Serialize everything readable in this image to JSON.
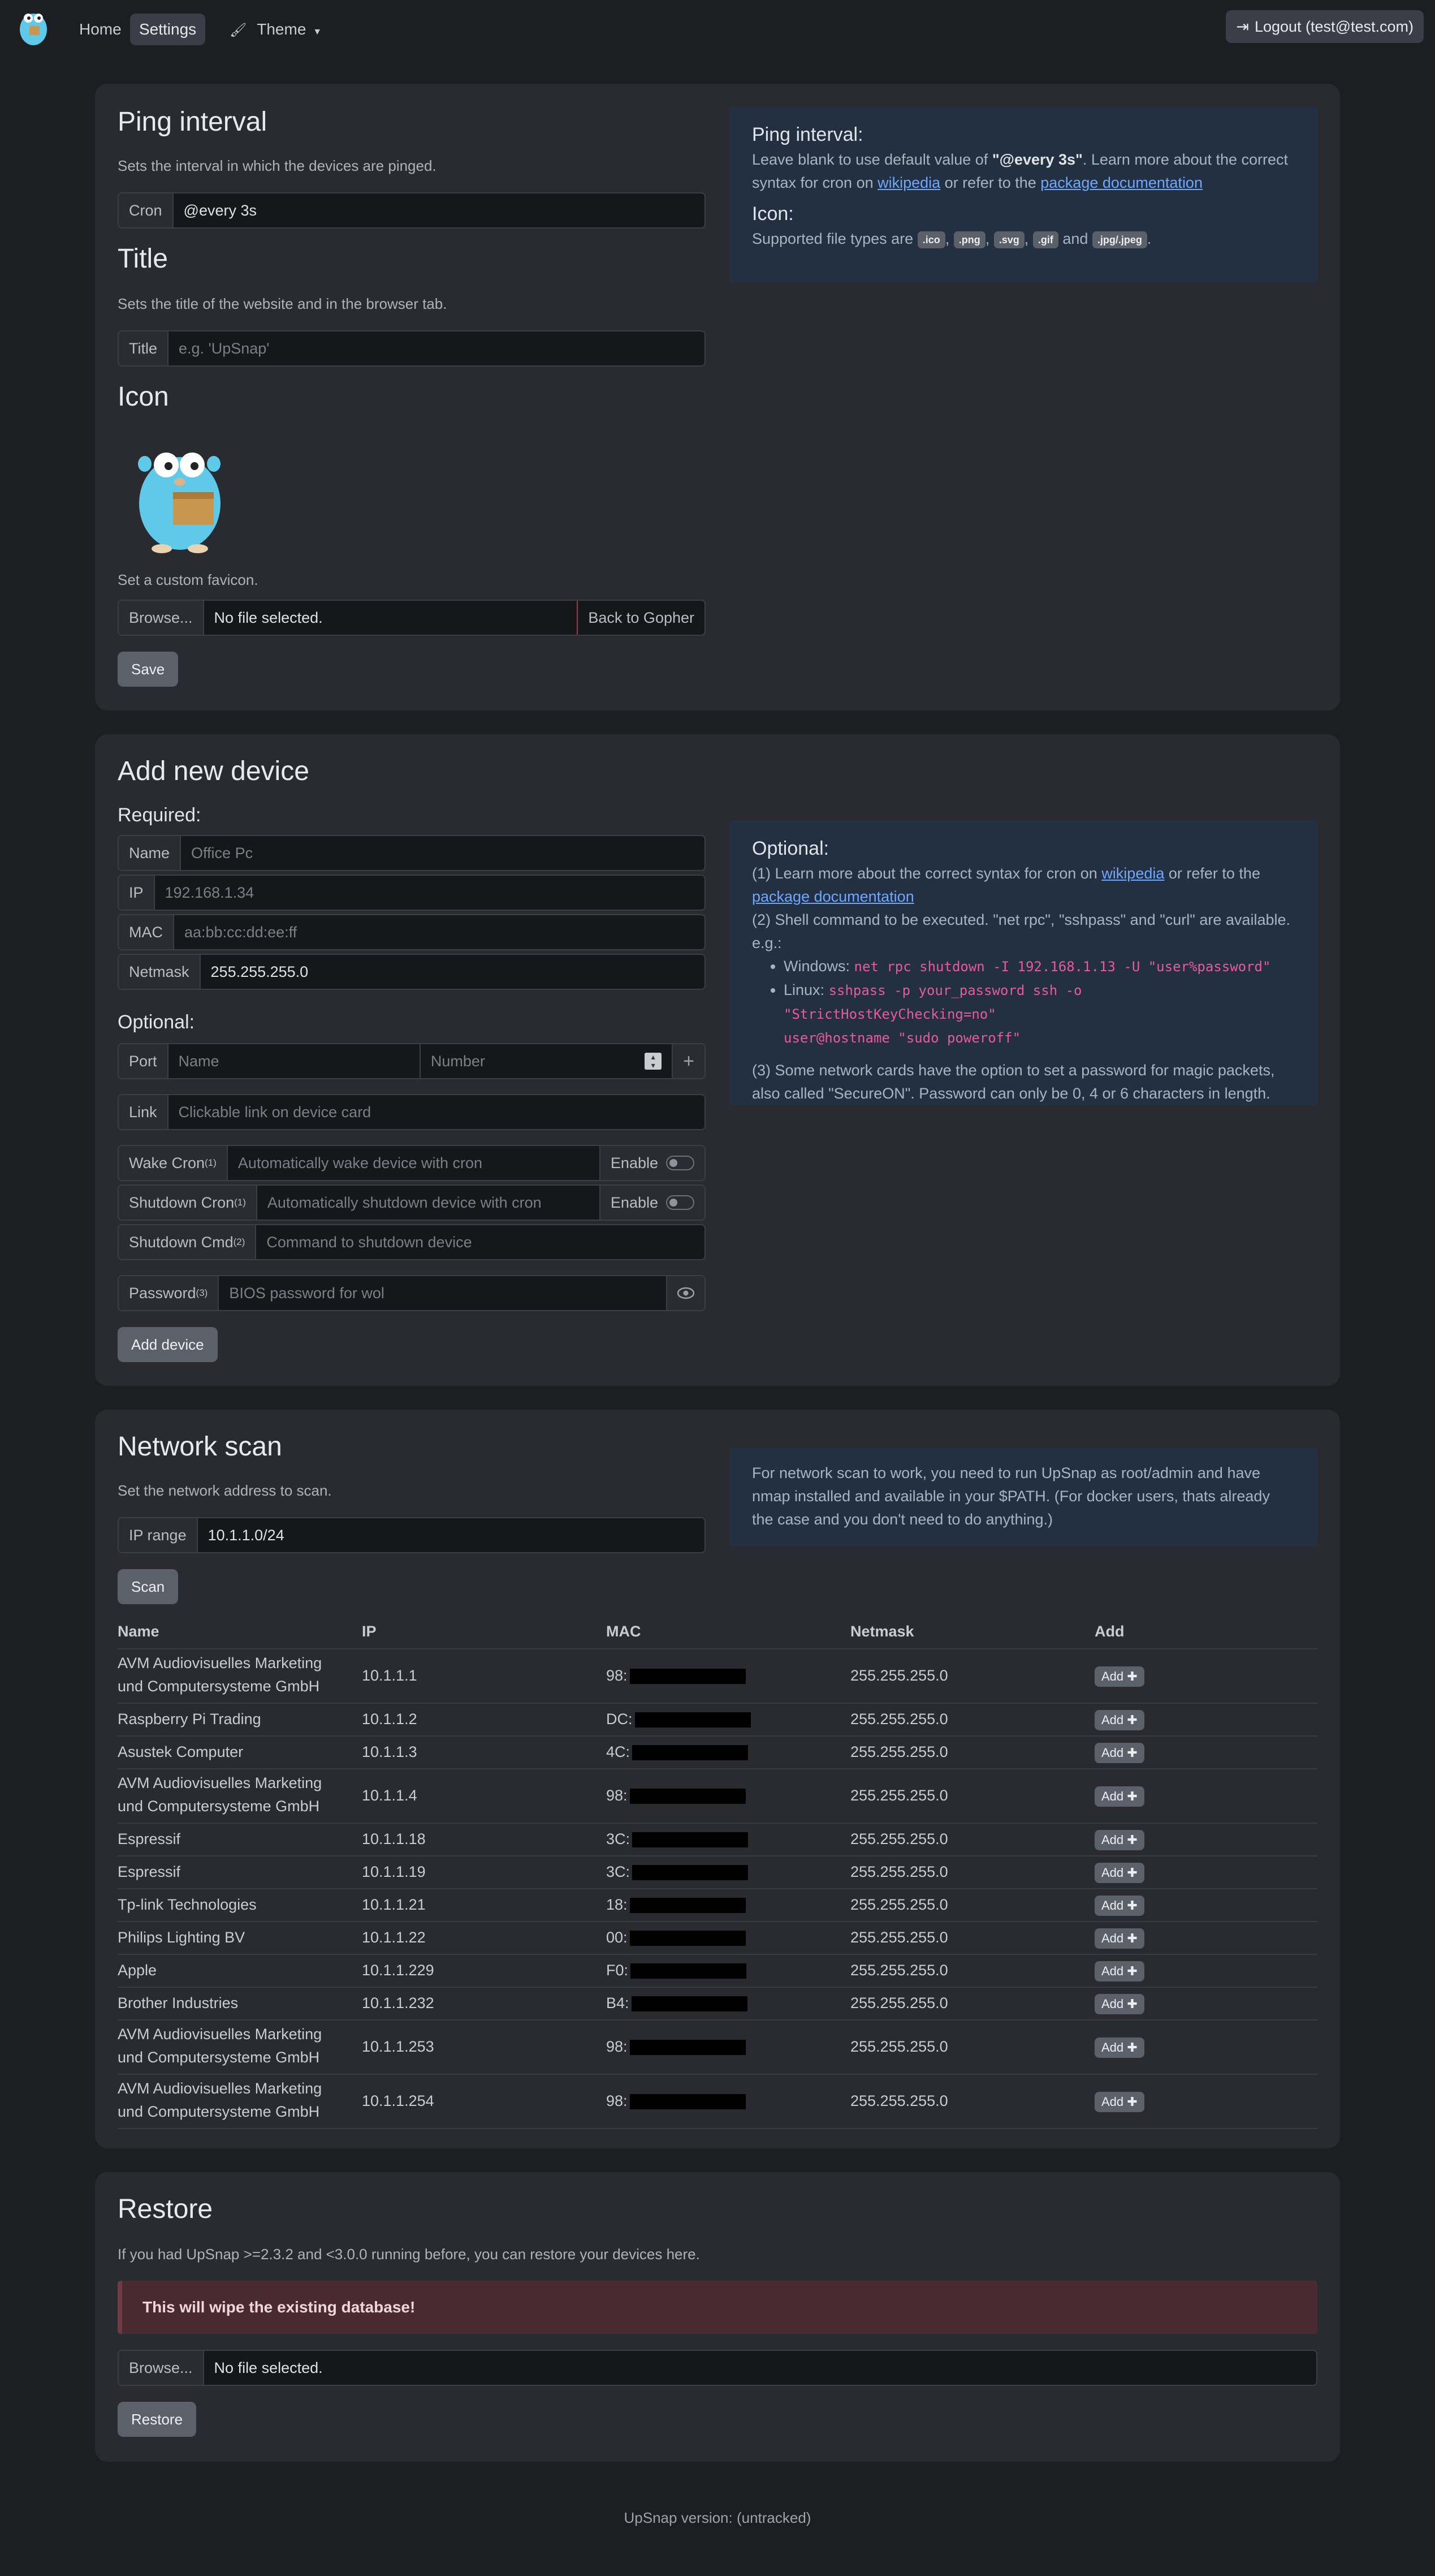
{
  "navbar": {
    "home": "Home",
    "settings": "Settings",
    "theme": "Theme",
    "logout": "Logout (test@test.com)"
  },
  "settings_card": {
    "ping_title": "Ping interval",
    "ping_desc": "Sets the interval in which the devices are pinged.",
    "cron_label": "Cron",
    "cron_value": "@every 3s",
    "title_title": "Title",
    "title_desc": "Sets the title of the website and in the browser tab.",
    "title_label": "Title",
    "title_placeholder": "e.g. 'UpSnap'",
    "icon_title": "Icon",
    "favicon_desc": "Set a custom favicon.",
    "browse": "Browse...",
    "no_file": "No file selected.",
    "back_to_gopher": "Back to Gopher",
    "save": "Save",
    "info": {
      "ping_heading": "Ping interval:",
      "ping_text_1": "Leave blank to use default value of ",
      "ping_default": "\"@every 3s\"",
      "ping_text_2": ". Learn more about the correct syntax for cron on ",
      "wikipedia": "wikipedia",
      "or_refer": " or refer to the ",
      "package_doc": "package documentation",
      "icon_heading": "Icon:",
      "icon_text": "Supported file types are ",
      "types": [
        ".ico",
        ".png",
        ".svg",
        ".gif",
        ".jpg/.jpeg"
      ],
      "and": "and",
      "comma": ","
    }
  },
  "device_card": {
    "title": "Add new device",
    "required": "Required:",
    "name_label": "Name",
    "name_placeholder": "Office Pc",
    "ip_label": "IP",
    "ip_placeholder": "192.168.1.34",
    "mac_label": "MAC",
    "mac_placeholder": "aa:bb:cc:dd:ee:ff",
    "netmask_label": "Netmask",
    "netmask_value": "255.255.255.0",
    "optional": "Optional:",
    "port_label": "Port",
    "port_name_placeholder": "Name",
    "port_number_placeholder": "Number",
    "plus": "+",
    "link_label": "Link",
    "link_placeholder": "Clickable link on device card",
    "wake_label": "Wake Cron",
    "wake_sup": "(1)",
    "wake_placeholder": "Automatically wake device with cron",
    "enable": "Enable",
    "shutdown_cron_label": "Shutdown Cron",
    "shutdown_cron_sup": "(1)",
    "shutdown_cron_placeholder": "Automatically shutdown device with cron",
    "shutdown_cmd_label": "Shutdown Cmd",
    "shutdown_cmd_sup": "(2)",
    "shutdown_cmd_placeholder": "Command to shutdown device",
    "password_label": "Password",
    "password_sup": "(3)",
    "password_placeholder": "BIOS password for wol",
    "add_device": "Add device",
    "info": {
      "heading": "Optional:",
      "p1_a": "(1) Learn more about the correct syntax for cron on ",
      "wikipedia": "wikipedia",
      "p1_b": " or refer to the",
      "package_doc": "package documentation",
      "p2": "(2) Shell command to be executed. \"net rpc\", \"sshpass\" and \"curl\" are available.",
      "eg": "e.g.:",
      "windows_label": "Windows: ",
      "windows_cmd": "net rpc shutdown -I 192.168.1.13 -U \"user%password\"",
      "linux_label": "Linux: ",
      "linux_cmd_1": "sshpass -p your_password ssh -o \"StrictHostKeyChecking=no\"",
      "linux_cmd_2": "user@hostname \"sudo poweroff\"",
      "p3": "(3) Some network cards have the option to set a password for magic packets, also called \"SecureON\". Password can only be 0, 4 or 6 characters in length."
    }
  },
  "scan_card": {
    "title": "Network scan",
    "desc": "Set the network address to scan.",
    "ip_range_label": "IP range",
    "ip_range_value": "10.1.1.0/24",
    "scan": "Scan",
    "info": "For network scan to work, you need to run UpSnap as root/admin and have nmap installed and available in your $PATH. (For docker users, thats already the case and you don't need to do anything.)",
    "headers": [
      "Name",
      "IP",
      "MAC",
      "Netmask",
      "Add"
    ],
    "add_label": "Add",
    "rows": [
      {
        "name": "AVM Audiovisuelles Marketing und Computersysteme GmbH",
        "ip": "10.1.1.1",
        "mac": "98:",
        "netmask": "255.255.255.0"
      },
      {
        "name": "Raspberry Pi Trading",
        "ip": "10.1.1.2",
        "mac": "DC:",
        "netmask": "255.255.255.0"
      },
      {
        "name": "Asustek Computer",
        "ip": "10.1.1.3",
        "mac": "4C:",
        "netmask": "255.255.255.0"
      },
      {
        "name": "AVM Audiovisuelles Marketing und Computersysteme GmbH",
        "ip": "10.1.1.4",
        "mac": "98:",
        "netmask": "255.255.255.0"
      },
      {
        "name": "Espressif",
        "ip": "10.1.1.18",
        "mac": "3C:",
        "netmask": "255.255.255.0"
      },
      {
        "name": "Espressif",
        "ip": "10.1.1.19",
        "mac": "3C:",
        "netmask": "255.255.255.0"
      },
      {
        "name": "Tp-link Technologies",
        "ip": "10.1.1.21",
        "mac": "18:",
        "netmask": "255.255.255.0"
      },
      {
        "name": "Philips Lighting BV",
        "ip": "10.1.1.22",
        "mac": "00:",
        "netmask": "255.255.255.0"
      },
      {
        "name": "Apple",
        "ip": "10.1.1.229",
        "mac": "F0:",
        "netmask": "255.255.255.0"
      },
      {
        "name": "Brother Industries",
        "ip": "10.1.1.232",
        "mac": "B4:",
        "netmask": "255.255.255.0"
      },
      {
        "name": "AVM Audiovisuelles Marketing und Computersysteme GmbH",
        "ip": "10.1.1.253",
        "mac": "98:",
        "netmask": "255.255.255.0"
      },
      {
        "name": "AVM Audiovisuelles Marketing und Computersysteme GmbH",
        "ip": "10.1.1.254",
        "mac": "98:",
        "netmask": "255.255.255.0"
      }
    ]
  },
  "restore_card": {
    "title": "Restore",
    "desc": "If you had UpSnap >=2.3.2 and <3.0.0 running before, you can restore your devices here.",
    "alert": "This will wipe the existing database!",
    "browse": "Browse...",
    "no_file": "No file selected.",
    "restore": "Restore"
  },
  "footer": {
    "version": "UpSnap version: (untracked)"
  },
  "colors": {
    "page_bg": "#1d1e22",
    "card_bg": "#2a2b31",
    "info_bg": "#223042",
    "link": "#6ea8fe",
    "danger": "#ea5a67",
    "alert_bg": "#4a2a31",
    "code_pink": "#e85a9b"
  },
  "icons": {
    "logo": "gopher-logo",
    "theme": "paint-brush-icon",
    "logout": "sign-out-icon",
    "eye": "eye-icon",
    "plus": "plus-icon",
    "caret": "caret-down-icon"
  }
}
